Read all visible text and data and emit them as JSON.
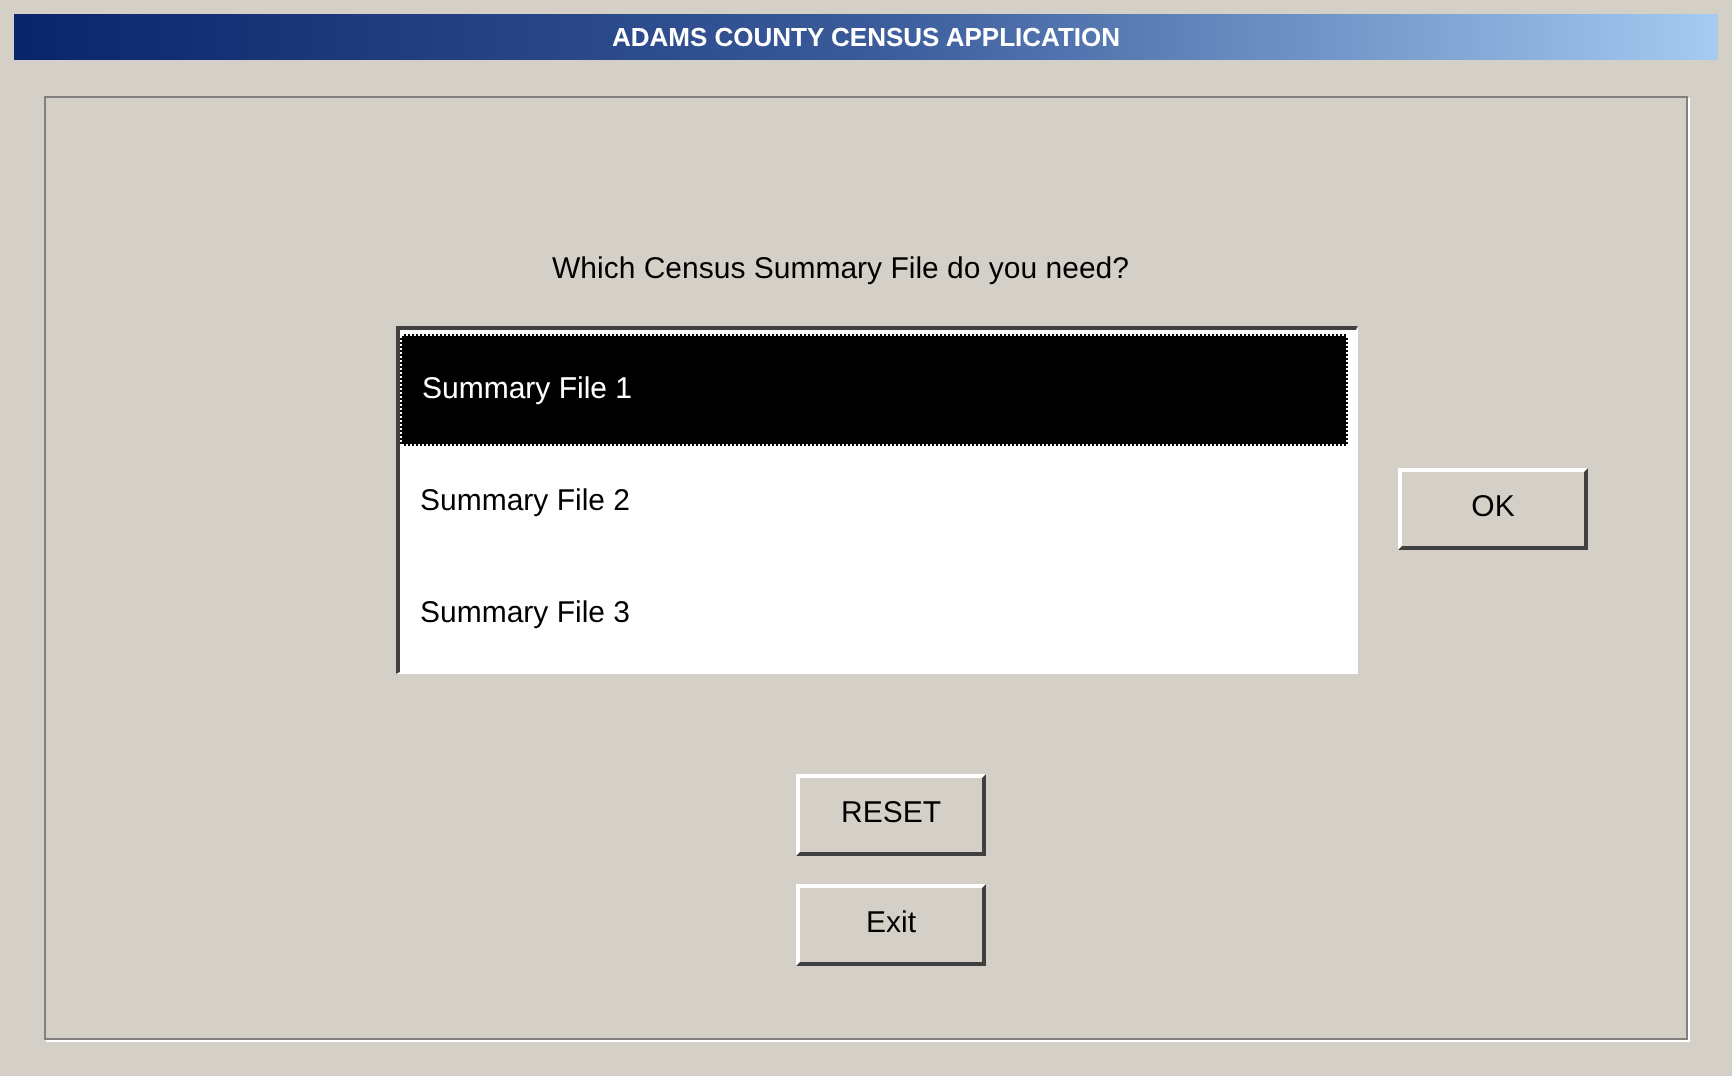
{
  "window": {
    "title": "ADAMS COUNTY CENSUS APPLICATION"
  },
  "prompt": "Which Census Summary File do you need?",
  "files": [
    {
      "label": "Summary File 1",
      "selected": true
    },
    {
      "label": "Summary File 2",
      "selected": false
    },
    {
      "label": "Summary File 3",
      "selected": false
    }
  ],
  "ok_button": "OK",
  "buttons": [
    "RESET",
    "Exit"
  ]
}
